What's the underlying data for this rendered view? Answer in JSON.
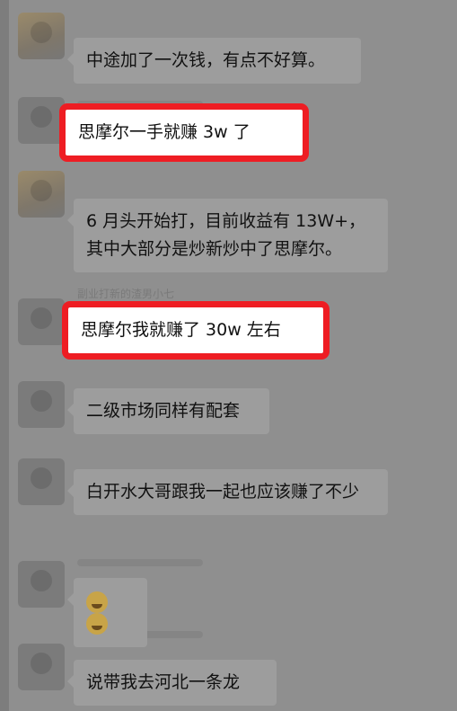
{
  "messages": [
    {
      "text": "中途加了一次钱，有点不好算。"
    },
    {
      "text": "思摩尔一手就赚 3w 了"
    },
    {
      "text": "6 月头开始打，目前收益有 13W+，其中大部分是炒新炒中了思摩尔。"
    },
    {
      "text": "思摩尔我就赚了 30w 左右"
    },
    {
      "text": "二级市场同样有配套"
    },
    {
      "text": "白开水大哥跟我一起也应该赚了不少"
    },
    {
      "text": "😭😭"
    },
    {
      "text": "说带我去河北一条龙"
    }
  ],
  "sender_label": "副业打新的渣男小七",
  "colors": {
    "highlight": "#ee1d23"
  },
  "icons": {
    "emoji": "crying-laughing-emoji"
  }
}
